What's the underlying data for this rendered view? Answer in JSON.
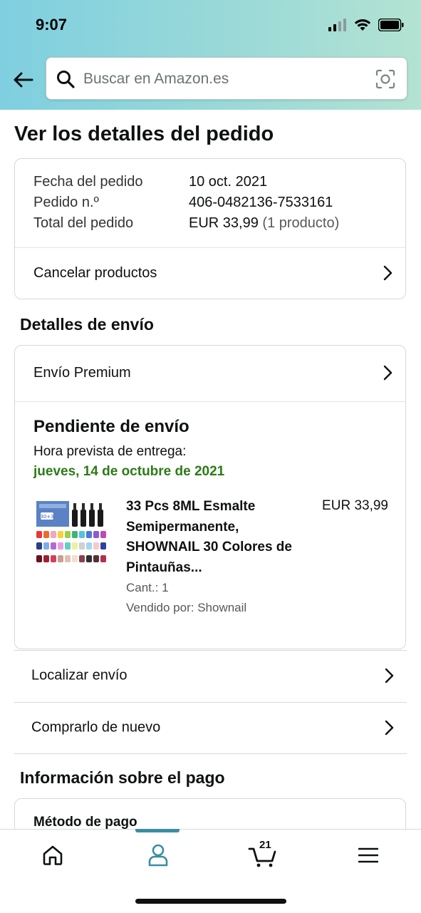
{
  "status_bar": {
    "time": "9:07"
  },
  "search": {
    "placeholder": "Buscar en Amazon.es"
  },
  "page": {
    "title": "Ver los detalles del pedido"
  },
  "order_summary": {
    "date_label": "Fecha del pedido",
    "date_value": "10 oct. 2021",
    "number_label": "Pedido n.º",
    "number_value": "406-0482136-7533161",
    "total_label": "Total del pedido",
    "total_value": "EUR 33,99",
    "total_count": "(1 producto)",
    "cancel_label": "Cancelar productos"
  },
  "shipping": {
    "section_title": "Detalles de envío",
    "method_label": "Envío Premium",
    "status": "Pendiente de envío",
    "eta_label": "Hora prevista de entrega:",
    "eta_date": "jueves, 14 de octubre de 2021",
    "eta_color": "#2c7a16",
    "product": {
      "title": "33 Pcs 8ML Esmalte Semipermanente, SHOWNAIL 30 Colores de Pintauñas...",
      "price": "EUR 33,99",
      "quantity": "Cant.: 1",
      "seller": "Vendido por: Shownail",
      "image_badge": "30+3"
    }
  },
  "actions": {
    "track_label": "Localizar envío",
    "buy_again_label": "Comprarlo de nuevo"
  },
  "payment": {
    "section_title": "Información sobre el pago",
    "method_label": "Método de pago"
  },
  "bottom_nav": {
    "items": [
      "home-icon",
      "account-icon",
      "cart-icon",
      "menu-icon"
    ],
    "active": "account-icon",
    "cart_count": "21",
    "accent": "#3b8ea3"
  }
}
